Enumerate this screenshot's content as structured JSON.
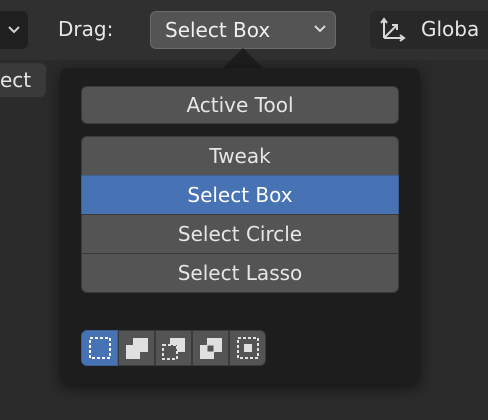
{
  "header": {
    "drag_label": "Drag:",
    "drag_value": "Select Box",
    "orientation_label": "Globa",
    "side_button_label": "ect"
  },
  "popup": {
    "active_tool_label": "Active Tool",
    "tools": [
      {
        "label": "Tweak",
        "selected": false
      },
      {
        "label": "Select Box",
        "selected": true
      },
      {
        "label": "Select Circle",
        "selected": false
      },
      {
        "label": "Select Lasso",
        "selected": false
      }
    ],
    "selection_modes": [
      {
        "icon": "select-set-icon",
        "selected": true
      },
      {
        "icon": "select-extend-icon",
        "selected": false
      },
      {
        "icon": "select-subtract-icon",
        "selected": false
      },
      {
        "icon": "select-difference-icon",
        "selected": false
      },
      {
        "icon": "select-intersect-icon",
        "selected": false
      }
    ]
  },
  "colors": {
    "accent": "#4772b3",
    "button": "#545454",
    "popup_bg": "#1d1d1d",
    "header_bg": "#303030"
  }
}
